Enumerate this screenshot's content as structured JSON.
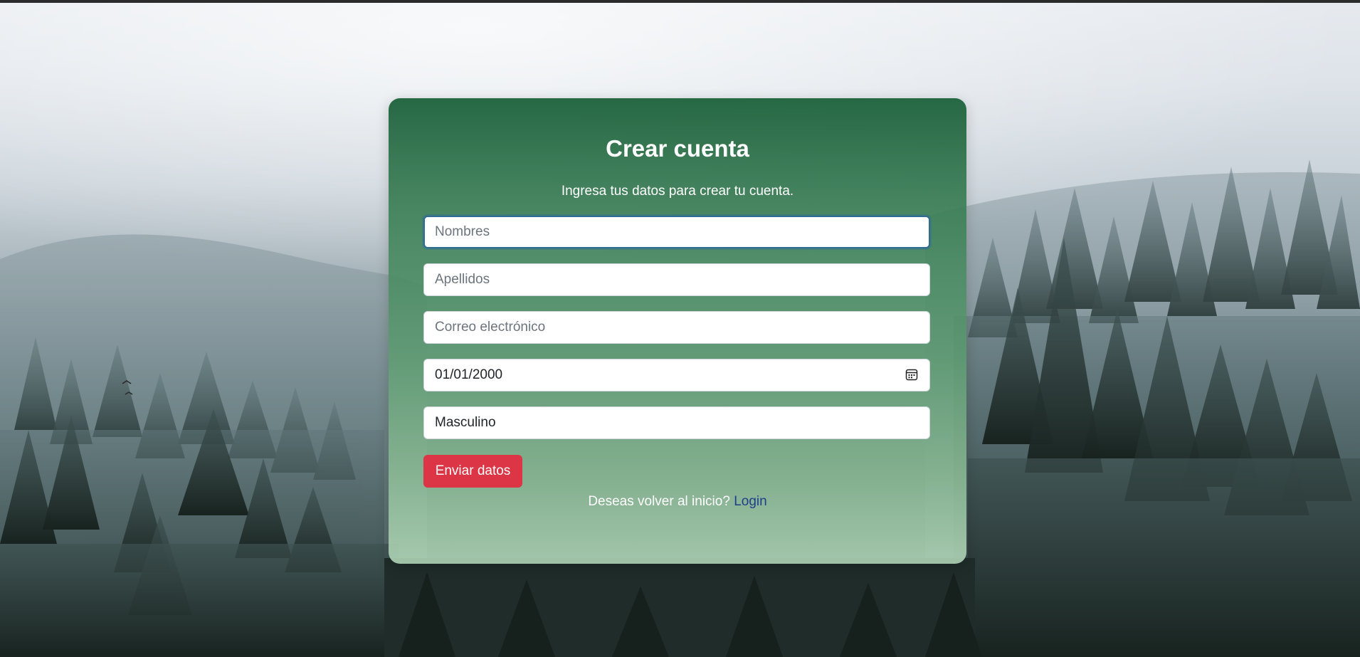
{
  "form": {
    "title": "Crear cuenta",
    "subtitle": "Ingresa tus datos para crear tu cuenta.",
    "fields": {
      "first_name": {
        "placeholder": "Nombres",
        "value": ""
      },
      "last_name": {
        "placeholder": "Apellidos",
        "value": ""
      },
      "email": {
        "placeholder": "Correo electrónico",
        "value": ""
      },
      "birth_date": {
        "value": "01/01/2000",
        "icon": "calendar-icon"
      },
      "gender": {
        "value": "Masculino"
      }
    },
    "submit_label": "Enviar datos",
    "footer_prompt": "Deseas volver al inicio?",
    "footer_link": "Login"
  },
  "colors": {
    "submit_button": "#dc3545",
    "focus_border": "#2e6b97",
    "link": "#1f3f8a",
    "card_top": "#20643e",
    "card_bottom": "#afd4b6"
  }
}
